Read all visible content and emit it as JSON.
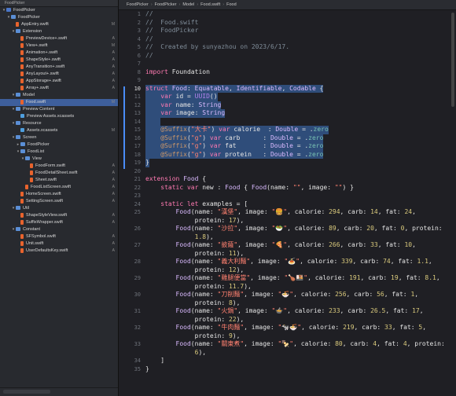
{
  "navigator": {
    "header": "FoodPicker",
    "items": [
      {
        "label": "FoodPicker",
        "depth": 0,
        "kind": "project",
        "disclosure": "▾"
      },
      {
        "label": "FoodPicker",
        "depth": 1,
        "kind": "folder",
        "disclosure": "▾"
      },
      {
        "label": "AppEntry.swift",
        "depth": 2,
        "kind": "swift",
        "disclosure": "",
        "status": "M"
      },
      {
        "label": "Extension",
        "depth": 2,
        "kind": "folder",
        "disclosure": "▾"
      },
      {
        "label": "PreviewDevice+.swift",
        "depth": 3,
        "kind": "swift",
        "disclosure": "",
        "status": "A"
      },
      {
        "label": "View+.swift",
        "depth": 3,
        "kind": "swift",
        "disclosure": "",
        "status": "M"
      },
      {
        "label": "Animation+.swift",
        "depth": 3,
        "kind": "swift",
        "disclosure": "",
        "status": "A"
      },
      {
        "label": "ShapeStyle+.swift",
        "depth": 3,
        "kind": "swift",
        "disclosure": "",
        "status": "A"
      },
      {
        "label": "AnyTransition+.swift",
        "depth": 3,
        "kind": "swift",
        "disclosure": "",
        "status": "A"
      },
      {
        "label": "AnyLayout+.swift",
        "depth": 3,
        "kind": "swift",
        "disclosure": "",
        "status": "A"
      },
      {
        "label": "AppStorage+.swift",
        "depth": 3,
        "kind": "swift",
        "disclosure": "",
        "status": "A"
      },
      {
        "label": "Array+.swift",
        "depth": 3,
        "kind": "swift",
        "disclosure": "",
        "status": "A"
      },
      {
        "label": "Model",
        "depth": 2,
        "kind": "folder",
        "disclosure": "▾"
      },
      {
        "label": "Food.swift",
        "depth": 3,
        "kind": "swift",
        "disclosure": "",
        "status": "M",
        "selected": true
      },
      {
        "label": "Preview Content",
        "depth": 2,
        "kind": "folder",
        "disclosure": "▾"
      },
      {
        "label": "Preview Assets.xcassets",
        "depth": 3,
        "kind": "assets",
        "disclosure": ""
      },
      {
        "label": "Resource",
        "depth": 2,
        "kind": "folder",
        "disclosure": "▾"
      },
      {
        "label": "Assets.xcassets",
        "depth": 3,
        "kind": "assets",
        "disclosure": "",
        "status": "M"
      },
      {
        "label": "Screen",
        "depth": 2,
        "kind": "folder",
        "disclosure": "▾"
      },
      {
        "label": "FoodPicker",
        "depth": 3,
        "kind": "folder",
        "disclosure": "▸"
      },
      {
        "label": "FoodList",
        "depth": 3,
        "kind": "folder",
        "disclosure": "▾"
      },
      {
        "label": "View",
        "depth": 4,
        "kind": "folder",
        "disclosure": "▾"
      },
      {
        "label": "FoodForm.swift",
        "depth": 5,
        "kind": "swift",
        "disclosure": "",
        "status": "A"
      },
      {
        "label": "FoodDetailSheet.swift",
        "depth": 5,
        "kind": "swift",
        "disclosure": "",
        "status": "A"
      },
      {
        "label": "Sheet.swift",
        "depth": 5,
        "kind": "swift",
        "disclosure": "",
        "status": "A"
      },
      {
        "label": "FoodListScreen.swift",
        "depth": 4,
        "kind": "swift",
        "disclosure": "",
        "status": "A"
      },
      {
        "label": "HomeScreen.swift",
        "depth": 3,
        "kind": "swift",
        "disclosure": "",
        "status": "A"
      },
      {
        "label": "SettingScreen.swift",
        "depth": 3,
        "kind": "swift",
        "disclosure": "",
        "status": "A"
      },
      {
        "label": "Util",
        "depth": 2,
        "kind": "folder",
        "disclosure": "▾"
      },
      {
        "label": "ShapeStyleView.swift",
        "depth": 3,
        "kind": "swift",
        "disclosure": "",
        "status": "A"
      },
      {
        "label": "SuffixWrapper.swift",
        "depth": 3,
        "kind": "swift",
        "disclosure": "",
        "status": "A"
      },
      {
        "label": "Constant",
        "depth": 2,
        "kind": "folder",
        "disclosure": "▾"
      },
      {
        "label": "SFSymbol.swift",
        "depth": 3,
        "kind": "swift",
        "disclosure": "",
        "status": "A"
      },
      {
        "label": "Unit.swift",
        "depth": 3,
        "kind": "swift",
        "disclosure": "",
        "status": "A"
      },
      {
        "label": "UserDefaultsKey.swift",
        "depth": 3,
        "kind": "swift",
        "disclosure": "",
        "status": "A"
      }
    ]
  },
  "jumpbar": {
    "crumbs": [
      "FoodPicker",
      "FoodPicker",
      "Model",
      "Food.swift",
      "Food"
    ]
  },
  "editor": {
    "lines": [
      {
        "n": "1",
        "html": "<span class=\"c\">//</span>"
      },
      {
        "n": "2",
        "html": "<span class=\"c\">//  Food.swift</span>"
      },
      {
        "n": "3",
        "html": "<span class=\"c\">//  FoodPicker</span>"
      },
      {
        "n": "4",
        "html": "<span class=\"c\">//</span>"
      },
      {
        "n": "5",
        "html": "<span class=\"c\">//  Created by sunyazhou on 2023/6/17.</span>"
      },
      {
        "n": "6",
        "html": "<span class=\"c\">//</span>"
      },
      {
        "n": "7",
        "html": ""
      },
      {
        "n": "8",
        "html": "<span class=\"k\">import</span> Foundation"
      },
      {
        "n": "9",
        "html": ""
      },
      {
        "n": "10",
        "html": "<span class=\"k\">struct</span> <span class=\"t\">Food</span>: <span class=\"t\">Equatable</span>, <span class=\"t\">Identifiable</span>, <span class=\"t\">Codable</span> {",
        "hl": true
      },
      {
        "n": "11",
        "html": "    <span class=\"k\">var</span> id = <span class=\"fn\">UUID</span>()",
        "hl": true
      },
      {
        "n": "12",
        "html": "    <span class=\"k\">var</span> name: <span class=\"t\">String</span>",
        "hl": true
      },
      {
        "n": "13",
        "html": "    <span class=\"k\">var</span> image: <span class=\"t\">String</span>",
        "hl": true
      },
      {
        "n": "14",
        "html": "    ",
        "hl": true
      },
      {
        "n": "15",
        "html": "    <span class=\"attr\">@Suffix</span>(<span class=\"s\">\"大卡\"</span>) <span class=\"k\">var</span> calorie  : <span class=\"t\">Double</span> = .<span class=\"id\">zero</span>",
        "hl": true
      },
      {
        "n": "16",
        "html": "    <span class=\"attr\">@Suffix</span>(<span class=\"s\">\"g\"</span>) <span class=\"k\">var</span> carb      : <span class=\"t\">Double</span> = .<span class=\"id\">zero</span>",
        "hl": true
      },
      {
        "n": "17",
        "html": "    <span class=\"attr\">@Suffix</span>(<span class=\"s\">\"g\"</span>) <span class=\"k\">var</span> fat       : <span class=\"t\">Double</span> = .<span class=\"id\">zero</span>",
        "hl": true
      },
      {
        "n": "18",
        "html": "    <span class=\"attr\">@Suffix</span>(<span class=\"s\">\"g\"</span>) <span class=\"k\">var</span> protein   : <span class=\"t\">Double</span> = .<span class=\"id\">zero</span>",
        "hl": true
      },
      {
        "n": "19",
        "html": "}",
        "hl": true
      },
      {
        "n": "20",
        "html": ""
      },
      {
        "n": "21",
        "html": "<span class=\"k\">extension</span> <span class=\"t\">Food</span> {"
      },
      {
        "n": "22",
        "html": "    <span class=\"k\">static var</span> new : <span class=\"t\">Food</span> { <span class=\"t\">Food</span>(name: <span class=\"s\">\"\"</span>, image: <span class=\"s\">\"\"</span>) }"
      },
      {
        "n": "23",
        "html": ""
      },
      {
        "n": "24",
        "html": "    <span class=\"k\">static let</span> examples = ["
      },
      {
        "n": "25",
        "html": "        <span class=\"t\">Food</span>(name: <span class=\"s\">\"漢堡\"</span>, image: <span class=\"s\">\"🍔\"</span>, calorie: <span class=\"n\">294</span>, carb: <span class=\"n\">14</span>, fat: <span class=\"n\">24</span>,"
      },
      {
        "n": "",
        "html": "             protein: <span class=\"n\">17</span>),"
      },
      {
        "n": "26",
        "html": "        <span class=\"t\">Food</span>(name: <span class=\"s\">\"沙拉\"</span>, image: <span class=\"s\">\"🥗\"</span>, calorie: <span class=\"n\">89</span>, carb: <span class=\"n\">20</span>, fat: <span class=\"n\">0</span>, protein:"
      },
      {
        "n": "",
        "html": "             <span class=\"n\">1.8</span>),"
      },
      {
        "n": "27",
        "html": "        <span class=\"t\">Food</span>(name: <span class=\"s\">\"披薩\"</span>, image: <span class=\"s\">\"🍕\"</span>, calorie: <span class=\"n\">266</span>, carb: <span class=\"n\">33</span>, fat: <span class=\"n\">10</span>,"
      },
      {
        "n": "",
        "html": "             protein: <span class=\"n\">11</span>),"
      },
      {
        "n": "28",
        "html": "        <span class=\"t\">Food</span>(name: <span class=\"s\">\"義大利麵\"</span>, image: <span class=\"s\">\"🍝\"</span>, calorie: <span class=\"n\">339</span>, carb: <span class=\"n\">74</span>, fat: <span class=\"n\">1.1</span>,"
      },
      {
        "n": "",
        "html": "             protein: <span class=\"n\">12</span>),"
      },
      {
        "n": "29",
        "html": "        <span class=\"t\">Food</span>(name: <span class=\"s\">\"雞腿便當\"</span>, image: <span class=\"s\">\"🍗🍱\"</span>, calorie: <span class=\"n\">191</span>, carb: <span class=\"n\">19</span>, fat: <span class=\"n\">8.1</span>,"
      },
      {
        "n": "",
        "html": "             protein: <span class=\"n\">11.7</span>),"
      },
      {
        "n": "30",
        "html": "        <span class=\"t\">Food</span>(name: <span class=\"s\">\"刀削麵\"</span>, image: <span class=\"s\">\"🍜\"</span>, calorie: <span class=\"n\">256</span>, carb: <span class=\"n\">56</span>, fat: <span class=\"n\">1</span>,"
      },
      {
        "n": "",
        "html": "             protein: <span class=\"n\">8</span>),"
      },
      {
        "n": "31",
        "html": "        <span class=\"t\">Food</span>(name: <span class=\"s\">\"火鍋\"</span>, image: <span class=\"s\">\"🍲\"</span>, calorie: <span class=\"n\">233</span>, carb: <span class=\"n\">26.5</span>, fat: <span class=\"n\">17</span>,"
      },
      {
        "n": "",
        "html": "             protein: <span class=\"n\">22</span>),"
      },
      {
        "n": "32",
        "html": "        <span class=\"t\">Food</span>(name: <span class=\"s\">\"牛肉麵\"</span>, image: <span class=\"s\">\"🐄🍜\"</span>, calorie: <span class=\"n\">219</span>, carb: <span class=\"n\">33</span>, fat: <span class=\"n\">5</span>,"
      },
      {
        "n": "",
        "html": "             protein: <span class=\"n\">9</span>),"
      },
      {
        "n": "33",
        "html": "        <span class=\"t\">Food</span>(name: <span class=\"s\">\"關東煮\"</span>, image: <span class=\"s\">\"🍢\"</span>, calorie: <span class=\"n\">80</span>, carb: <span class=\"n\">4</span>, fat: <span class=\"n\">4</span>, protein:"
      },
      {
        "n": "",
        "html": "             <span class=\"n\">6</span>),"
      },
      {
        "n": "34",
        "html": "    ]"
      },
      {
        "n": "35",
        "html": "}"
      }
    ]
  }
}
